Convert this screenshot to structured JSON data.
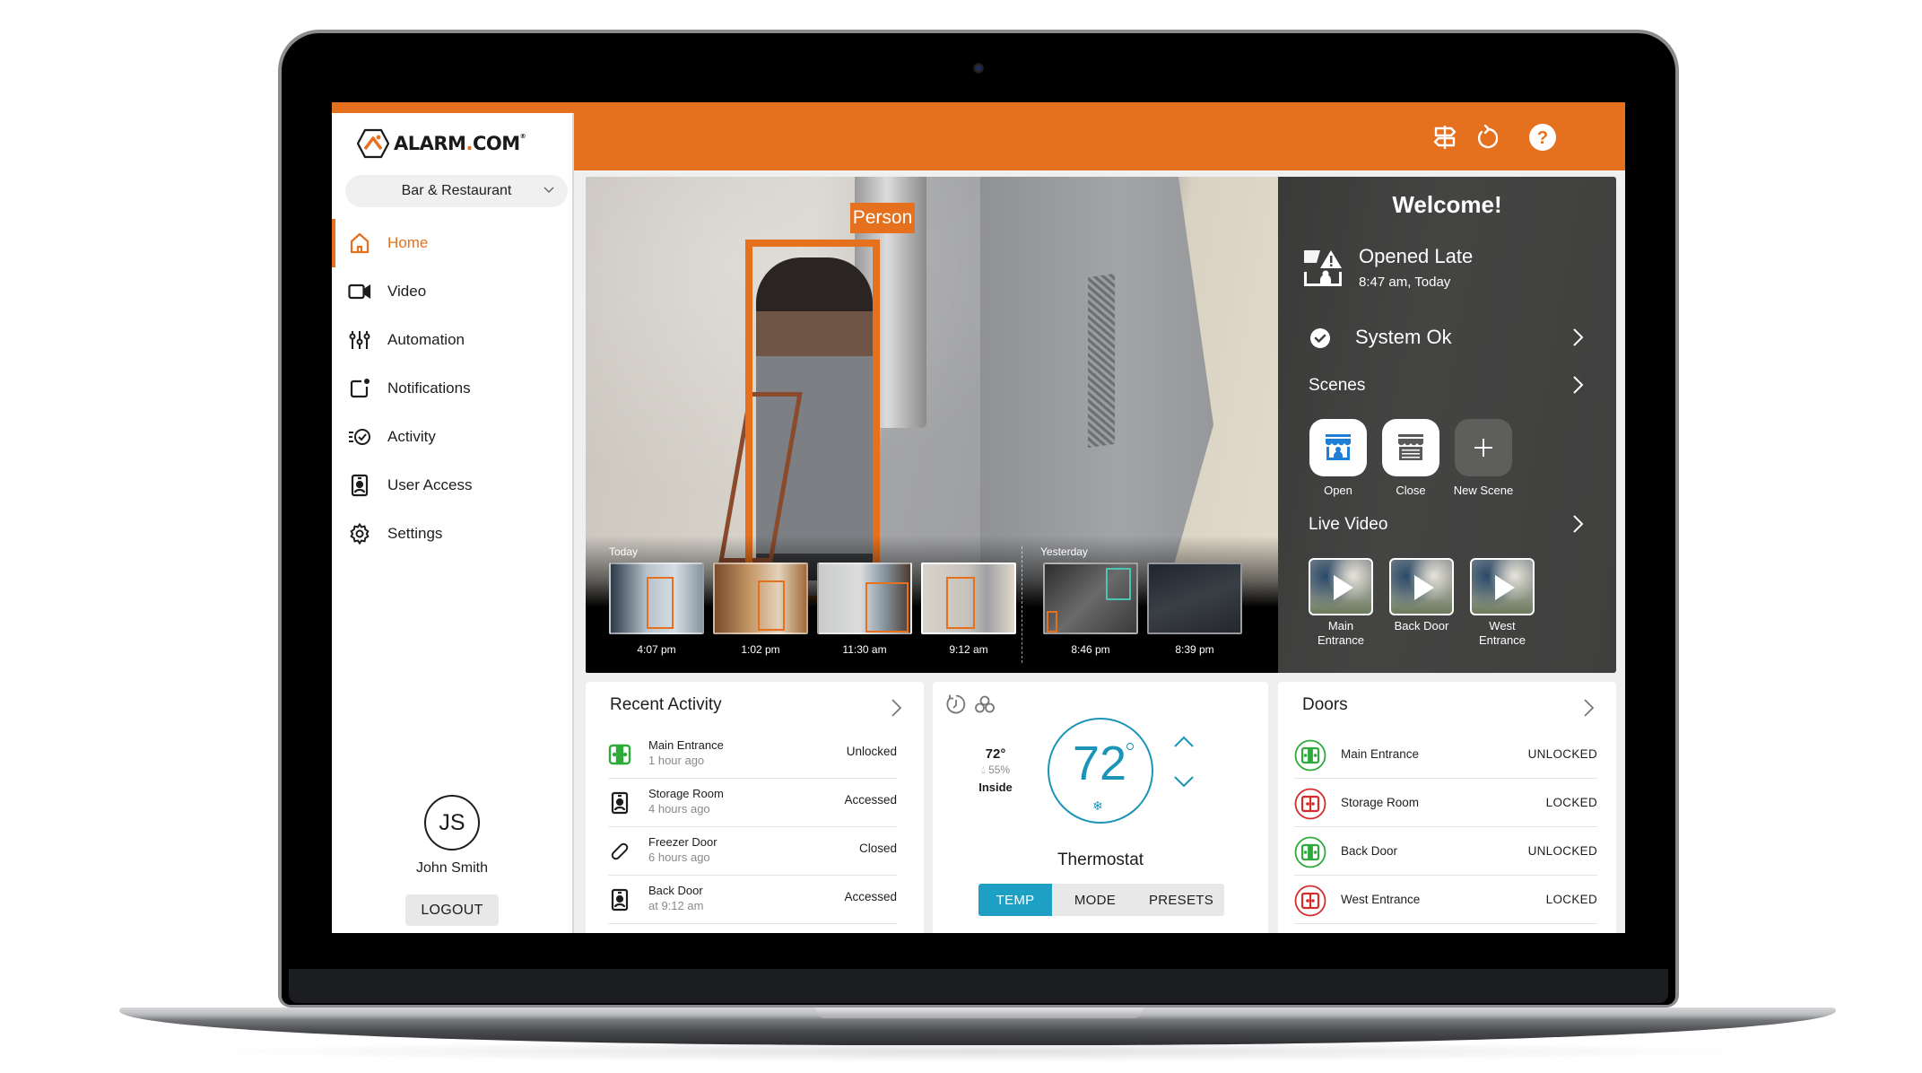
{
  "app": {
    "brand": "ALARM.COM",
    "accent_color": "#e5701e",
    "site_selector": {
      "value": "Bar & Restaurant"
    }
  },
  "topbar": {
    "icons": [
      "signpost-icon",
      "refresh-icon",
      "help-icon"
    ]
  },
  "sidebar": {
    "items": [
      {
        "label": "Home",
        "icon": "home-icon",
        "active": true
      },
      {
        "label": "Video",
        "icon": "video-camera-icon",
        "active": false
      },
      {
        "label": "Automation",
        "icon": "sliders-icon",
        "active": false
      },
      {
        "label": "Notifications",
        "icon": "notification-icon",
        "active": false
      },
      {
        "label": "Activity",
        "icon": "activity-icon",
        "active": false
      },
      {
        "label": "User Access",
        "icon": "user-badge-icon",
        "active": false
      },
      {
        "label": "Settings",
        "icon": "gear-icon",
        "active": false
      }
    ],
    "user": {
      "initials": "JS",
      "name": "John Smith",
      "logout_label": "LOGOUT"
    }
  },
  "video": {
    "detection_label": "Person",
    "groups": [
      {
        "label": "Today",
        "clips": [
          {
            "time": "4:07 pm"
          },
          {
            "time": "1:02 pm"
          },
          {
            "time": "11:30 am"
          },
          {
            "time": "9:12 am",
            "selected": true
          }
        ]
      },
      {
        "label": "Yesterday",
        "clips": [
          {
            "time": "8:46 pm"
          },
          {
            "time": "8:39 pm"
          }
        ]
      }
    ]
  },
  "panel": {
    "welcome": "Welcome!",
    "alert": {
      "title": "Opened Late",
      "time": "8:47 am, Today",
      "icon": "opened-late-icon"
    },
    "system_status": "System Ok",
    "scenes": {
      "title": "Scenes",
      "items": [
        {
          "label": "Open",
          "icon": "store-open-icon"
        },
        {
          "label": "Close",
          "icon": "store-closed-icon"
        },
        {
          "label": "New Scene",
          "icon": "plus-icon"
        }
      ]
    },
    "live_video": {
      "title": "Live Video",
      "items": [
        {
          "label": "Main Entrance"
        },
        {
          "label": "Back Door"
        },
        {
          "label": "West Entrance"
        }
      ]
    }
  },
  "recent_activity": {
    "title": "Recent Activity",
    "rows": [
      {
        "name": "Main Entrance",
        "time": "1 hour ago",
        "status": "Unlocked",
        "icon": "door-unlocked-icon"
      },
      {
        "name": "Storage Room",
        "time": "4 hours ago",
        "status": "Accessed",
        "icon": "access-badge-icon"
      },
      {
        "name": "Freezer Door",
        "time": "6 hours ago",
        "status": "Closed",
        "icon": "contact-sensor-icon"
      },
      {
        "name": "Back Door",
        "time": "at 9:12 am",
        "status": "Accessed",
        "icon": "access-badge-icon"
      }
    ]
  },
  "thermostat": {
    "title": "Thermostat",
    "setpoint": "72",
    "inside_temp": "72°",
    "humidity": "55%",
    "inside_label": "Inside",
    "mode_icon": "snowflake-icon",
    "tabs": [
      {
        "label": "TEMP",
        "active": true
      },
      {
        "label": "MODE",
        "active": false
      },
      {
        "label": "PRESETS",
        "active": false
      }
    ],
    "colors": {
      "accent": "#1a95b8"
    }
  },
  "doors": {
    "title": "Doors",
    "rows": [
      {
        "name": "Main Entrance",
        "status": "UNLOCKED",
        "color": "#2eaa3a"
      },
      {
        "name": "Storage Room",
        "status": "LOCKED",
        "color": "#d42b2b"
      },
      {
        "name": "Back Door",
        "status": "UNLOCKED",
        "color": "#2eaa3a"
      },
      {
        "name": "West Entrance",
        "status": "LOCKED",
        "color": "#d42b2b"
      }
    ]
  }
}
